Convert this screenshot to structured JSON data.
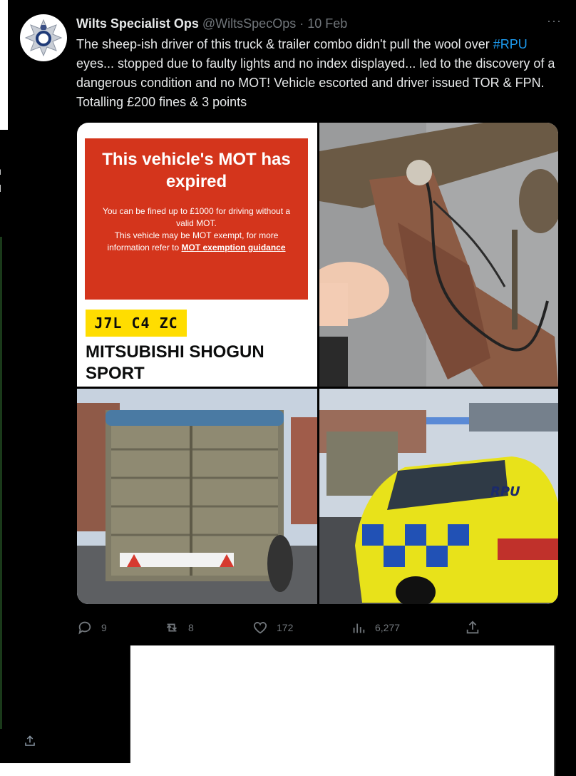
{
  "background_panel": {
    "fragments": [
      "u",
      "d"
    ]
  },
  "tweet": {
    "author_name": "Wilts Specialist Ops",
    "handle": "@WiltsSpecOps",
    "separator": "·",
    "date": "10 Feb",
    "more_label": "···",
    "text_before_tag": "The sheep-ish driver of this truck & trailer combo didn't pull the wool over ",
    "hashtag": "#RPU",
    "text_after_tag": " eyes... stopped due to faulty lights and no index displayed... led to the discovery of a dangerous condition and no MOT! Vehicle escorted and driver issued TOR & FPN. Totalling £200 fines & 3 points"
  },
  "mot_card": {
    "title": "This vehicle's MOT has expired",
    "line1": "You can be fined up to £1000 for driving without a valid MOT.",
    "line2": "This vehicle may be MOT exempt, for more information refer to ",
    "link": "MOT exemption guidance",
    "plate": "J7L C4 ZC",
    "vehicle": "MITSUBISHI SHOGUN SPORT"
  },
  "police_car": {
    "livery_text": "RPU"
  },
  "metrics": {
    "replies": "9",
    "retweets": "8",
    "likes": "172",
    "views": "6,277"
  },
  "colors": {
    "background": "#000000",
    "text": "#e7e9ea",
    "muted": "#71767b",
    "link": "#1d9bf0",
    "mot_red": "#d4351c",
    "plate_yellow": "#ffdd00"
  },
  "icons": [
    "police-crest-icon",
    "reply-icon",
    "retweet-icon",
    "like-icon",
    "views-icon",
    "share-icon"
  ]
}
